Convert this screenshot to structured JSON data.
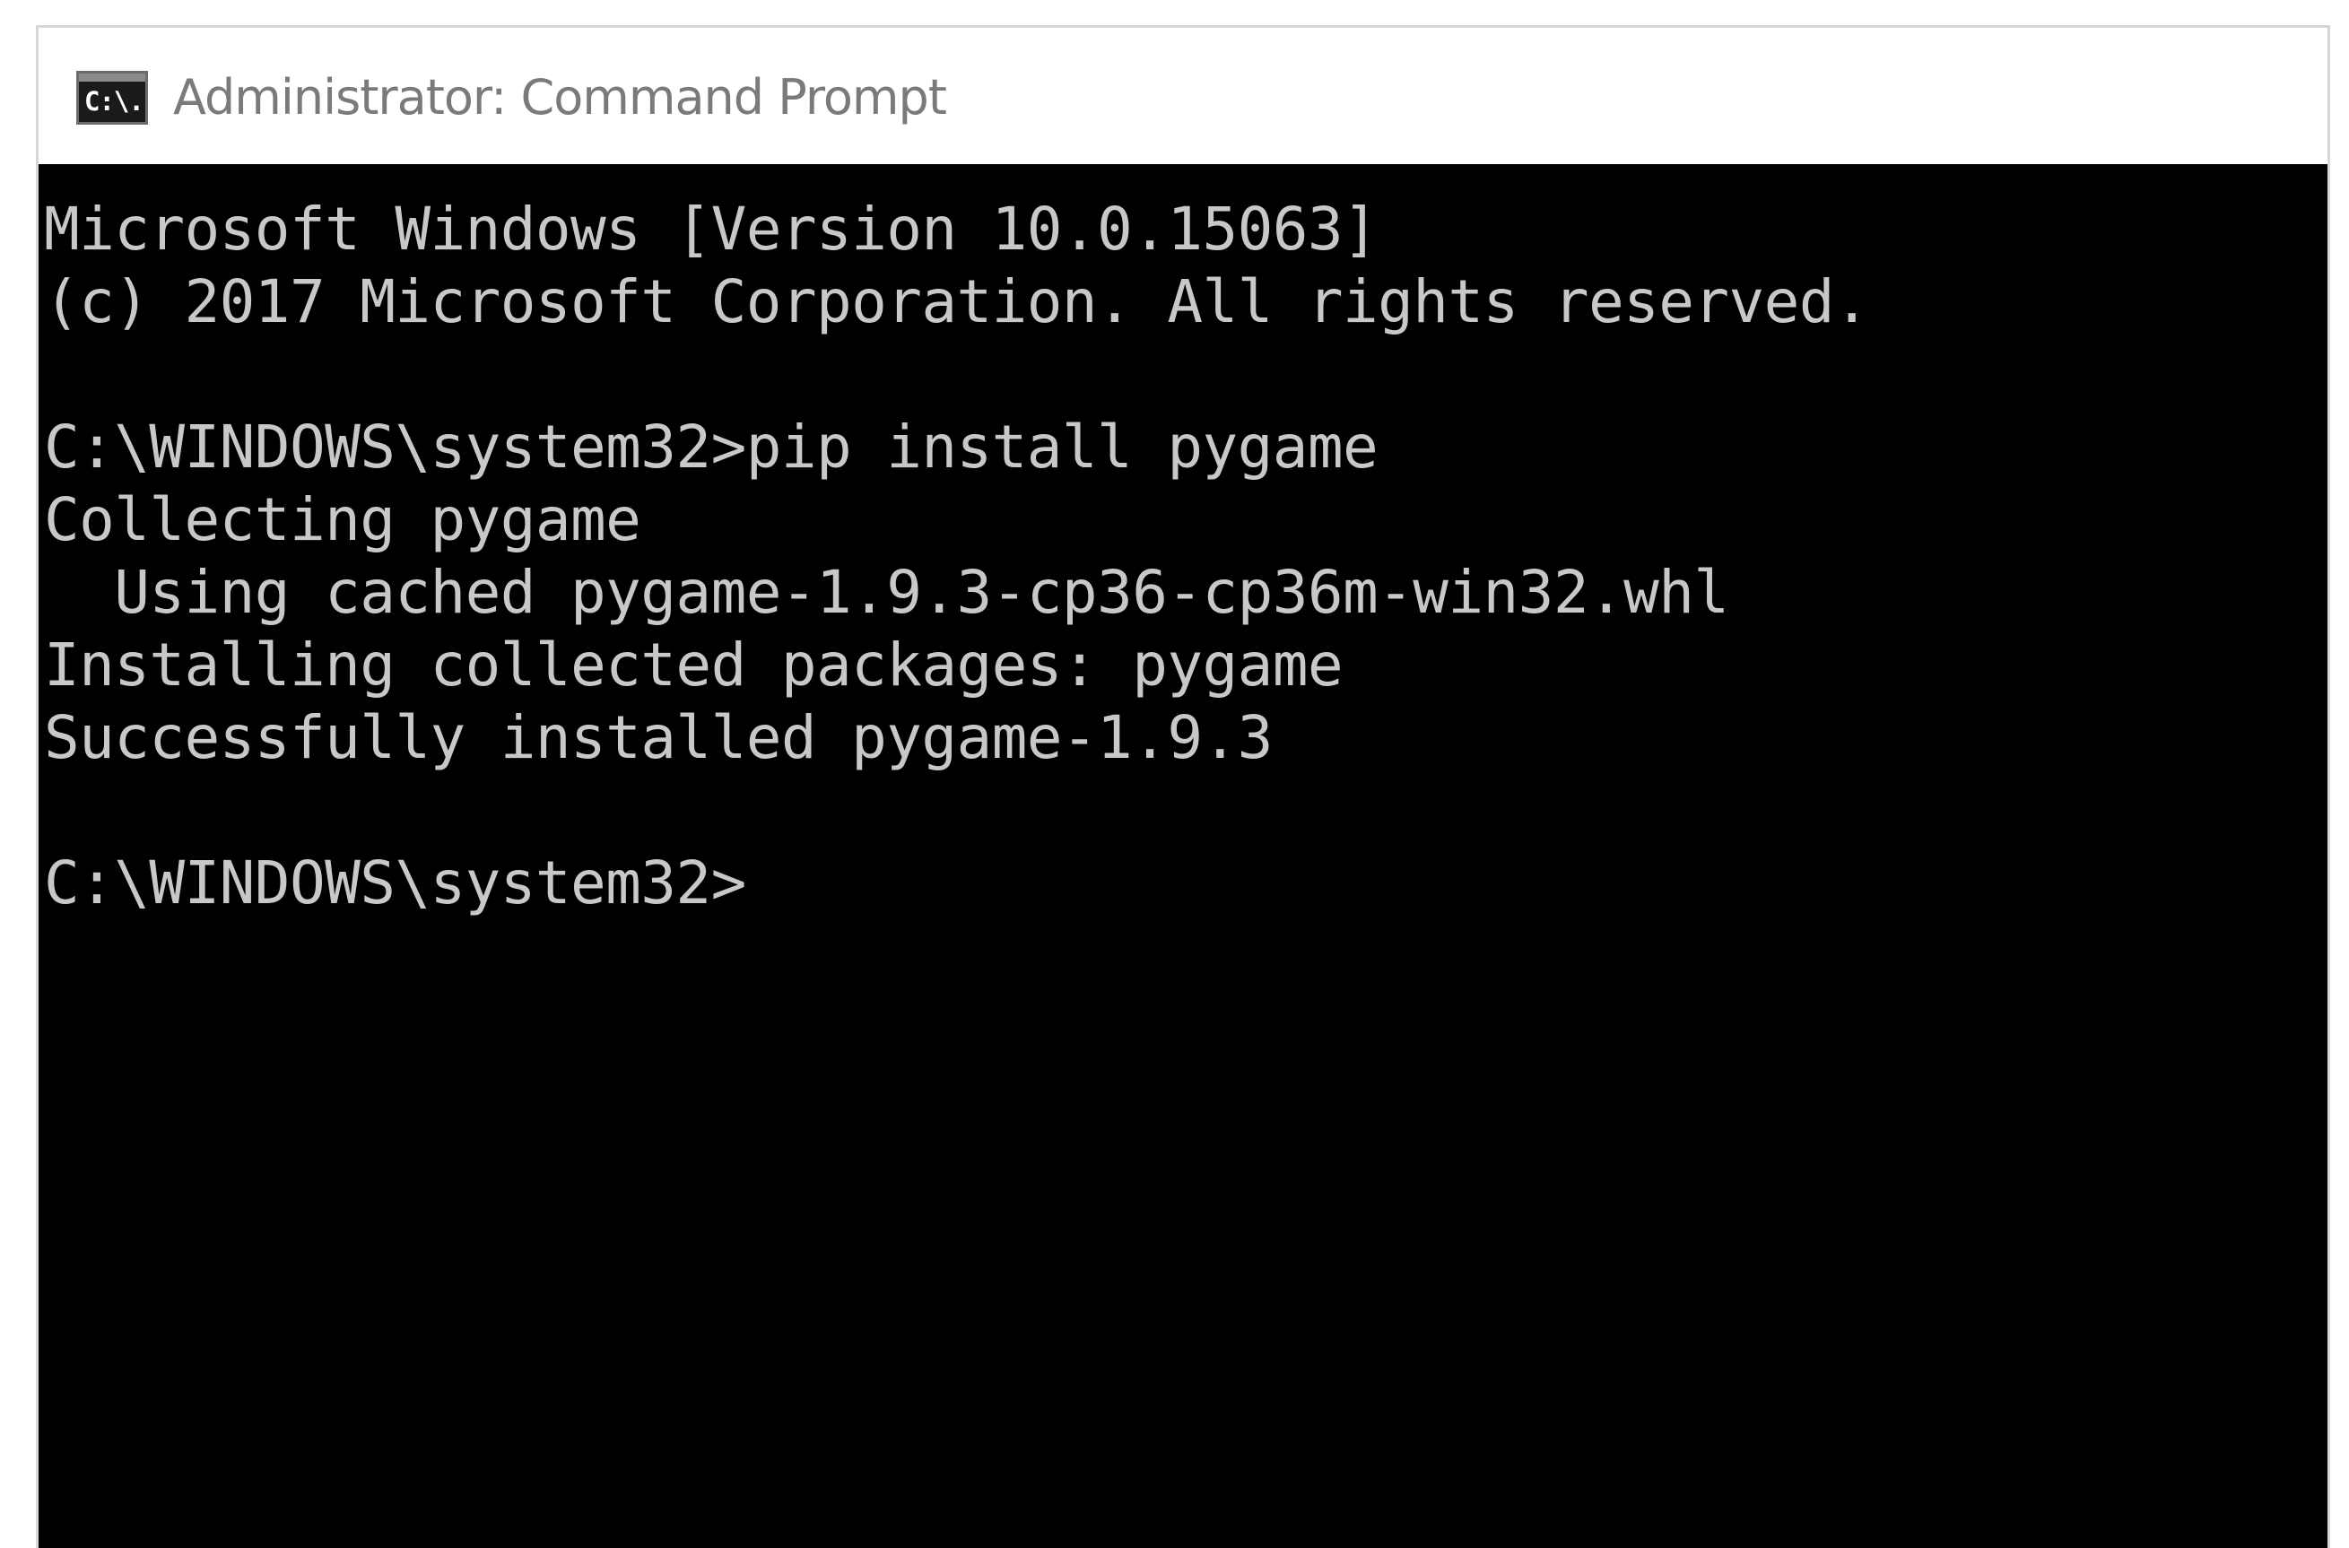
{
  "window": {
    "title": "Administrator: Command Prompt",
    "icon": "cmd-icon",
    "icon_label": "C:\\."
  },
  "console": {
    "lines": [
      "Microsoft Windows [Version 10.0.15063]",
      "(c) 2017 Microsoft Corporation. All rights reserved.",
      "",
      "C:\\WINDOWS\\system32>pip install pygame",
      "Collecting pygame",
      "  Using cached pygame-1.9.3-cp36-cp36m-win32.whl",
      "Installing collected packages: pygame",
      "Successfully installed pygame-1.9.3",
      "",
      "C:\\WINDOWS\\system32>"
    ]
  },
  "colors": {
    "console_background": "#000000",
    "console_text": "#c8c8c8",
    "title_text": "#7a7a7a"
  }
}
